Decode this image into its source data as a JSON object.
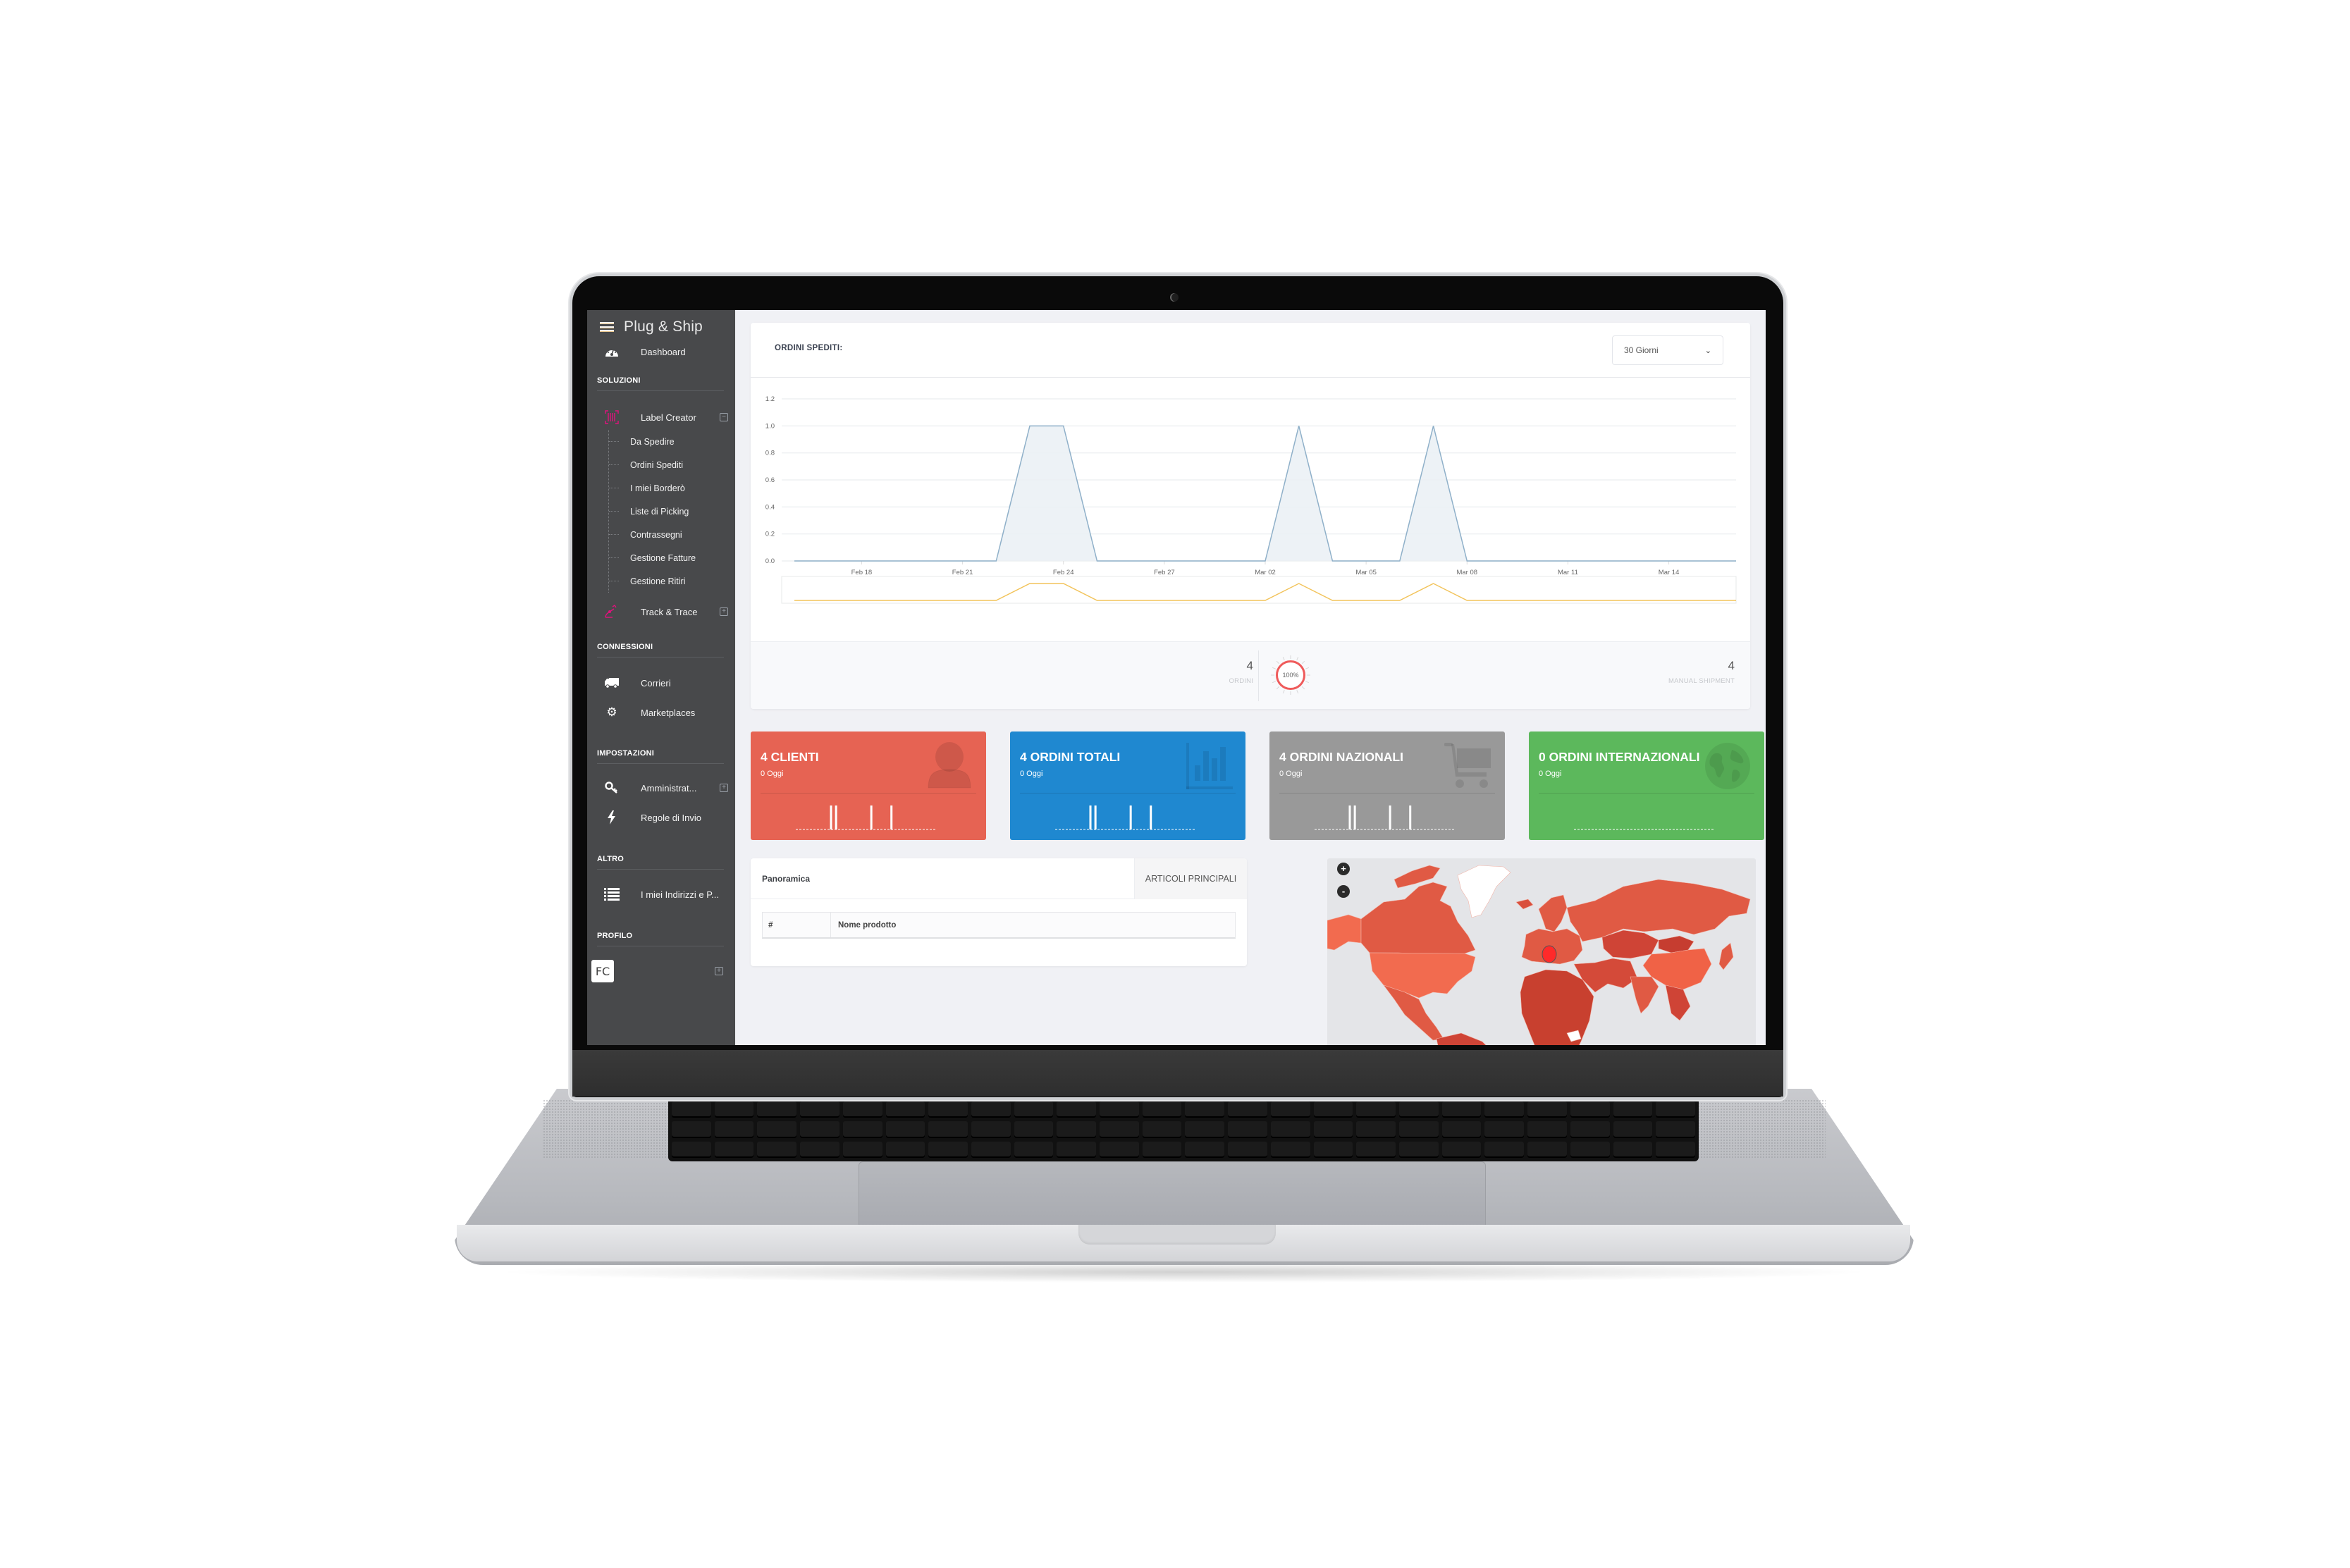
{
  "app": {
    "brand": "Plug & Ship",
    "accent_color": "#e0127c"
  },
  "sidebar": {
    "dashboard": {
      "label": "Dashboard",
      "icon": "dashboard-gauge-icon"
    },
    "sections": [
      {
        "title": "SOLUZIONI"
      },
      {
        "title": "CONNESSIONI"
      },
      {
        "title": "IMPOSTAZIONI"
      },
      {
        "title": "ALTRO"
      },
      {
        "title": "PROFILO"
      }
    ],
    "label_creator": {
      "label": "Label Creator",
      "icon": "barcode-icon",
      "expanded": true,
      "toggle": "⊟",
      "children": [
        "Da Spedire",
        "Ordini Spediti",
        "I miei Borderò",
        "Liste di Picking",
        "Contrassegni",
        "Gestione Fatture",
        "Gestione Ritiri"
      ]
    },
    "track_trace": {
      "label": "Track & Trace",
      "icon": "route-icon",
      "toggle": "⊞"
    },
    "corrieri": {
      "label": "Corrieri",
      "icon": "truck-icon"
    },
    "marketplaces": {
      "label": "Marketplaces",
      "icon": "gears-icon"
    },
    "amministrazione": {
      "label": "Amministrat...",
      "icon": "key-icon",
      "toggle": "⊞"
    },
    "regole": {
      "label": "Regole di Invio",
      "icon": "bolt-icon"
    },
    "indirizzi": {
      "label": "I miei Indirizzi e P...",
      "icon": "list-icon"
    },
    "profile": {
      "initials": "FC",
      "toggle": "⊞"
    }
  },
  "orders_chart": {
    "title": "ORDINI SPEDITI:",
    "range_select": {
      "value": "30 Giorni"
    },
    "stats": [
      {
        "value": "4",
        "label": "ORDINI"
      },
      {
        "value": "4",
        "label": "MANUAL SHIPMENT"
      }
    ],
    "gauge": {
      "label": "100%",
      "value": 100
    }
  },
  "chart_data": {
    "type": "area",
    "title": "ORDINI SPEDITI:",
    "xlabel": "",
    "ylabel": "",
    "ylim": [
      0,
      1.2
    ],
    "yticks": [
      "0.0",
      "0.2",
      "0.4",
      "0.6",
      "0.8",
      "1.0",
      "1.2"
    ],
    "xtick_labels": [
      "Feb 18",
      "Feb 21",
      "Feb 24",
      "Feb 27",
      "Mar 02",
      "Mar 05",
      "Mar 08",
      "Mar 11",
      "Mar 14"
    ],
    "x": [
      "Feb 16",
      "Feb 17",
      "Feb 18",
      "Feb 19",
      "Feb 20",
      "Feb 21",
      "Feb 22",
      "Feb 23",
      "Feb 24",
      "Feb 25",
      "Feb 26",
      "Feb 27",
      "Feb 28",
      "Mar 01",
      "Mar 02",
      "Mar 03",
      "Mar 04",
      "Mar 05",
      "Mar 06",
      "Mar 07",
      "Mar 08",
      "Mar 09",
      "Mar 10",
      "Mar 11",
      "Mar 12",
      "Mar 13",
      "Mar 14",
      "Mar 15",
      "Mar 16"
    ],
    "series": [
      {
        "name": "Ordini",
        "values": [
          0,
          0,
          0,
          0,
          0,
          0,
          0,
          1,
          1,
          0,
          0,
          0,
          0,
          0,
          0,
          1,
          0,
          0,
          0,
          1,
          0,
          0,
          0,
          0,
          0,
          0,
          0,
          0,
          0
        ]
      }
    ],
    "grid": true,
    "navigator": true,
    "colors": {
      "line": "#8fb0c9",
      "fill": "#eaf0f5",
      "navigator": "#f2c35a"
    }
  },
  "tiles": [
    {
      "title": "4 CLIENTI",
      "sub": "0 Oggi",
      "color": "#e66353",
      "icon": "user-icon",
      "spark": [
        0,
        0,
        0,
        0,
        0,
        0,
        0,
        1,
        1,
        0,
        0,
        0,
        0,
        0,
        0,
        1,
        0,
        0,
        0,
        1,
        0,
        0,
        0,
        0,
        0,
        0,
        0,
        0,
        0
      ]
    },
    {
      "title": "4 ORDINI TOTALI",
      "sub": "0 Oggi",
      "color": "#1f88d0",
      "icon": "bar-chart-icon",
      "spark": [
        0,
        0,
        0,
        0,
        0,
        0,
        0,
        1,
        1,
        0,
        0,
        0,
        0,
        0,
        0,
        1,
        0,
        0,
        0,
        1,
        0,
        0,
        0,
        0,
        0,
        0,
        0,
        0,
        0
      ]
    },
    {
      "title": "4 ORDINI NAZIONALI",
      "sub": "0 Oggi",
      "color": "#999999",
      "icon": "cart-icon",
      "spark": [
        0,
        0,
        0,
        0,
        0,
        0,
        0,
        1,
        1,
        0,
        0,
        0,
        0,
        0,
        0,
        1,
        0,
        0,
        0,
        1,
        0,
        0,
        0,
        0,
        0,
        0,
        0,
        0,
        0
      ]
    },
    {
      "title": "0 ORDINI INTERNAZIONALI",
      "sub": "0 Oggi",
      "color": "#5cb85c",
      "icon": "globe-icon",
      "spark": [
        0,
        0,
        0,
        0,
        0,
        0,
        0,
        0,
        0,
        0,
        0,
        0,
        0,
        0,
        0,
        0,
        0,
        0,
        0,
        0,
        0,
        0,
        0,
        0,
        0,
        0,
        0,
        0,
        0
      ]
    }
  ],
  "overview": {
    "title": "Panoramica",
    "tab": "ARTICOLI PRINCIPALI",
    "columns": [
      "#",
      "Nome prodotto"
    ],
    "rows": []
  },
  "map": {
    "zoom_in": "+",
    "zoom_out": "-",
    "highlight_country": "Italy",
    "marker_color": "#ff2a2a"
  }
}
